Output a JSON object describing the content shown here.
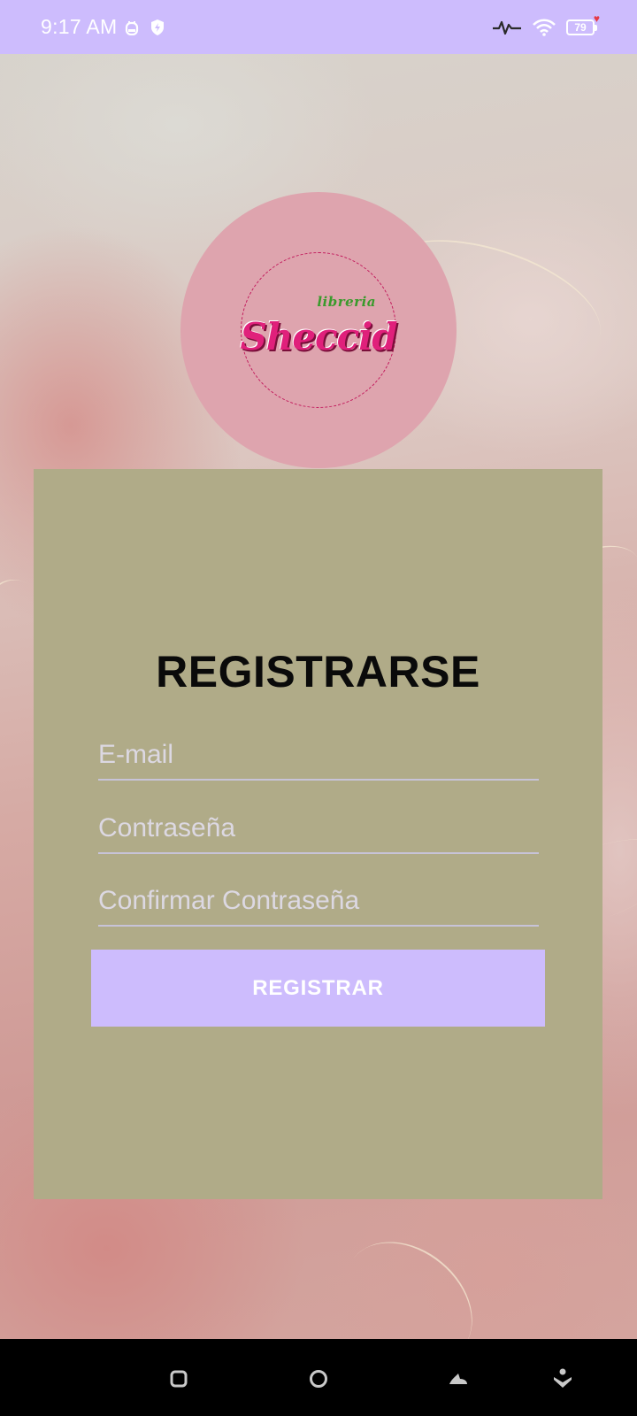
{
  "status_bar": {
    "time": "9:17 AM",
    "battery_level": "79",
    "icons": [
      "alarm-icon",
      "vpn-shield-icon",
      "activity-icon",
      "wifi-icon",
      "battery-icon"
    ]
  },
  "logo": {
    "small_text": "libreria",
    "brand_text": "Sheccid"
  },
  "form": {
    "title": "REGISTRARSE",
    "email_placeholder": "E-mail",
    "password_placeholder": "Contraseña",
    "confirm_placeholder": "Confirmar Contraseña",
    "submit_label": "REGISTRAR"
  },
  "nav_bar": {
    "buttons": [
      "recents-square-icon",
      "home-circle-icon",
      "back-icon",
      "assistant-icon"
    ]
  },
  "colors": {
    "status_bar": "#cdbcfd",
    "card": "#b0ab88",
    "button": "#cdbcfd",
    "logo_circle": "#dea4ae",
    "brand_pink": "#e0207b",
    "brand_green": "#3a9a2c"
  }
}
